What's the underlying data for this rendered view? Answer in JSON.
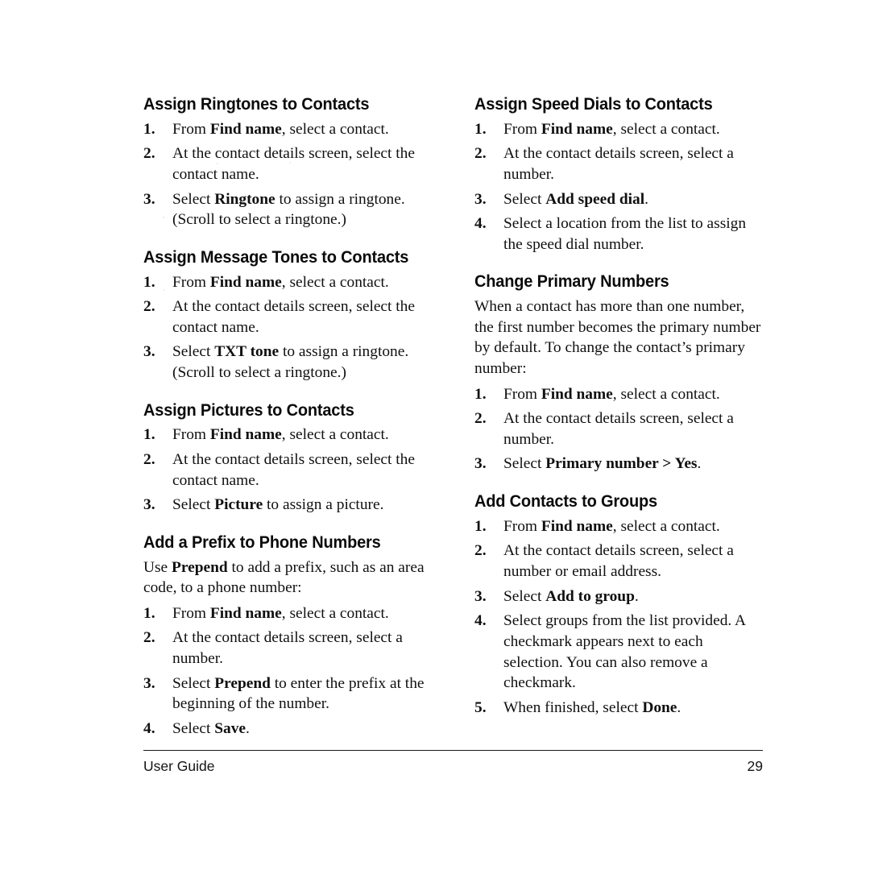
{
  "document": {
    "footer": {
      "left_label": "User Guide",
      "page_number": "29"
    }
  },
  "columns": [
    {
      "sections": [
        {
          "heading": "Assign Ringtones to Contacts",
          "steps": [
            {
              "number": "1.",
              "segments": [
                {
                  "text": "From ",
                  "bold": false
                },
                {
                  "text": "Find name",
                  "bold": true
                },
                {
                  "text": ", select a contact.",
                  "bold": false
                }
              ]
            },
            {
              "number": "2.",
              "segments": [
                {
                  "text": "At the contact details screen, select the contact name.",
                  "bold": false
                }
              ]
            },
            {
              "number": "3.",
              "segments": [
                {
                  "text": "Select ",
                  "bold": false
                },
                {
                  "text": "Ringtone",
                  "bold": true
                },
                {
                  "text": " to assign a ringtone. (Scroll to select a ringtone.)",
                  "bold": false
                }
              ]
            }
          ]
        },
        {
          "heading": "Assign Message Tones to Contacts",
          "steps": [
            {
              "number": "1.",
              "segments": [
                {
                  "text": "From ",
                  "bold": false
                },
                {
                  "text": "Find name",
                  "bold": true
                },
                {
                  "text": ", select a contact.",
                  "bold": false
                }
              ]
            },
            {
              "number": "2.",
              "segments": [
                {
                  "text": "At the contact details screen, select the contact name.",
                  "bold": false
                }
              ]
            },
            {
              "number": "3.",
              "segments": [
                {
                  "text": "Select ",
                  "bold": false
                },
                {
                  "text": "TXT tone",
                  "bold": true
                },
                {
                  "text": " to assign a ringtone. (Scroll to select a ringtone.)",
                  "bold": false
                }
              ]
            }
          ]
        },
        {
          "heading": "Assign Pictures to Contacts",
          "steps": [
            {
              "number": "1.",
              "segments": [
                {
                  "text": "From ",
                  "bold": false
                },
                {
                  "text": "Find name",
                  "bold": true
                },
                {
                  "text": ", select a contact.",
                  "bold": false
                }
              ]
            },
            {
              "number": "2.",
              "segments": [
                {
                  "text": "At the contact details screen, select the contact name.",
                  "bold": false
                }
              ]
            },
            {
              "number": "3.",
              "segments": [
                {
                  "text": "Select ",
                  "bold": false
                },
                {
                  "text": "Picture",
                  "bold": true
                },
                {
                  "text": " to assign a picture.",
                  "bold": false
                }
              ]
            }
          ]
        },
        {
          "heading": "Add a Prefix to Phone Numbers",
          "intro": [
            {
              "text": "Use ",
              "bold": false
            },
            {
              "text": "Prepend",
              "bold": true
            },
            {
              "text": " to add a prefix, such as an area code, to a phone number:",
              "bold": false
            }
          ],
          "steps": [
            {
              "number": "1.",
              "segments": [
                {
                  "text": "From ",
                  "bold": false
                },
                {
                  "text": "Find name",
                  "bold": true
                },
                {
                  "text": ", select a contact.",
                  "bold": false
                }
              ]
            },
            {
              "number": "2.",
              "segments": [
                {
                  "text": "At the contact details screen, select a number.",
                  "bold": false
                }
              ]
            },
            {
              "number": "3.",
              "segments": [
                {
                  "text": "Select ",
                  "bold": false
                },
                {
                  "text": "Prepend",
                  "bold": true
                },
                {
                  "text": " to enter the prefix at the beginning of the number.",
                  "bold": false
                }
              ]
            },
            {
              "number": "4.",
              "segments": [
                {
                  "text": "Select ",
                  "bold": false
                },
                {
                  "text": "Save",
                  "bold": true
                },
                {
                  "text": ".",
                  "bold": false
                }
              ]
            }
          ]
        }
      ]
    },
    {
      "sections": [
        {
          "heading": "Assign Speed Dials to Contacts",
          "steps": [
            {
              "number": "1.",
              "segments": [
                {
                  "text": "From ",
                  "bold": false
                },
                {
                  "text": "Find name",
                  "bold": true
                },
                {
                  "text": ", select a contact.",
                  "bold": false
                }
              ]
            },
            {
              "number": "2.",
              "segments": [
                {
                  "text": "At the contact details screen, select a number.",
                  "bold": false
                }
              ]
            },
            {
              "number": "3.",
              "segments": [
                {
                  "text": "Select ",
                  "bold": false
                },
                {
                  "text": "Add speed dial",
                  "bold": true
                },
                {
                  "text": ".",
                  "bold": false
                }
              ]
            },
            {
              "number": "4.",
              "segments": [
                {
                  "text": "Select a location from the list to assign the speed dial number.",
                  "bold": false
                }
              ]
            }
          ]
        },
        {
          "heading": "Change Primary Numbers",
          "intro": [
            {
              "text": "When a contact has more than one number, the first number becomes the primary number by default. To change the contact’s primary number:",
              "bold": false
            }
          ],
          "steps": [
            {
              "number": "1.",
              "segments": [
                {
                  "text": "From ",
                  "bold": false
                },
                {
                  "text": "Find name",
                  "bold": true
                },
                {
                  "text": ", select a contact.",
                  "bold": false
                }
              ]
            },
            {
              "number": "2.",
              "segments": [
                {
                  "text": "At the contact details screen, select a number.",
                  "bold": false
                }
              ]
            },
            {
              "number": "3.",
              "segments": [
                {
                  "text": "Select ",
                  "bold": false
                },
                {
                  "text": "Primary number > Yes",
                  "bold": true
                },
                {
                  "text": ".",
                  "bold": false
                }
              ]
            }
          ]
        },
        {
          "heading": "Add Contacts to Groups",
          "steps": [
            {
              "number": "1.",
              "segments": [
                {
                  "text": "From ",
                  "bold": false
                },
                {
                  "text": "Find name",
                  "bold": true
                },
                {
                  "text": ", select a contact.",
                  "bold": false
                }
              ]
            },
            {
              "number": "2.",
              "segments": [
                {
                  "text": "At the contact details screen, select a number or email address.",
                  "bold": false
                }
              ]
            },
            {
              "number": "3.",
              "segments": [
                {
                  "text": "Select ",
                  "bold": false
                },
                {
                  "text": "Add to group",
                  "bold": true
                },
                {
                  "text": ".",
                  "bold": false
                }
              ]
            },
            {
              "number": "4.",
              "segments": [
                {
                  "text": "Select groups from the list provided. A checkmark appears next to each selection. You can also remove a checkmark.",
                  "bold": false
                }
              ]
            },
            {
              "number": "5.",
              "segments": [
                {
                  "text": "When finished, select ",
                  "bold": false
                },
                {
                  "text": "Done",
                  "bold": true
                },
                {
                  "text": ".",
                  "bold": false
                }
              ]
            }
          ]
        }
      ]
    }
  ]
}
